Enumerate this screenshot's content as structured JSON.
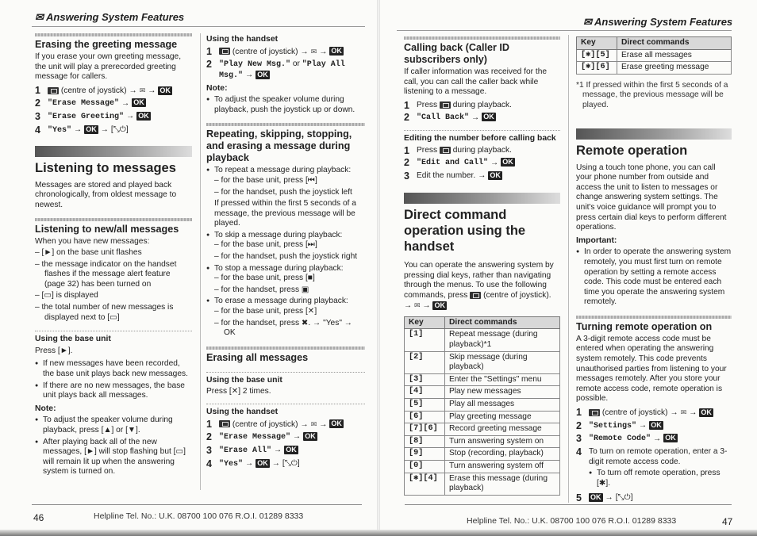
{
  "header": {
    "title": "Answering System Features",
    "icon": "answering-system-icon"
  },
  "icons": {
    "ok": "OK",
    "arrow": "→",
    "off": "[⤡⏻]"
  },
  "left_page": {
    "number": "46",
    "footer": "Helpline Tel. No.: U.K. 08700 100 076  R.O.I. 01289 8333",
    "erasing_greeting": {
      "title": "Erasing the greeting message",
      "intro": "If you erase your own greeting message, the unit will play a prerecorded greeting message for callers.",
      "steps": [
        {
          "n": "1",
          "text": "(centre of joystick)"
        },
        {
          "n": "2",
          "text": "\"Erase Message\""
        },
        {
          "n": "3",
          "text": "\"Erase Greeting\""
        },
        {
          "n": "4",
          "text": "\"Yes\""
        }
      ]
    },
    "listening": {
      "title": "Listening to messages",
      "intro": "Messages are stored and played back chronologically, from oldest message to newest."
    },
    "new_all": {
      "title": "Listening to new/all messages",
      "intro": "When you have new messages:",
      "items": [
        "– [►] on the base unit flashes",
        "– the message indicator on the handset flashes if the message alert feature (page 32) has been turned on",
        "– [▭] is displayed",
        "– the total number of new messages is displayed next to [▭]"
      ]
    },
    "base_unit": {
      "title": "Using the base unit",
      "press": "Press [►].",
      "bullets": [
        "If new messages have been recorded, the base unit plays back new messages.",
        "If there are no new messages, the base unit plays back all messages."
      ],
      "note_label": "Note:",
      "notes": [
        "To adjust the speaker volume during playback, press [▲] or [▼].",
        "After playing back all of the new messages, [►] will stop flashing but [▭] will remain lit up when the answering system is turned on."
      ]
    },
    "handset": {
      "title": "Using the handset",
      "steps": [
        {
          "n": "1",
          "text": "(centre of joystick)"
        },
        {
          "n": "2",
          "text_a": "\"Play New Msg.\"",
          "or": " or ",
          "text_b": "\"Play All Msg.\""
        }
      ],
      "note_label": "Note:",
      "notes": [
        "To adjust the speaker volume during playback, push the joystick up or down."
      ]
    },
    "repeating": {
      "title": "Repeating, skipping, stopping, and erasing a message during playback",
      "groups": [
        {
          "bullet": "To repeat a message during playback:",
          "items": [
            "– for the base unit, press [⏮]",
            "– for the handset, push the joystick left"
          ],
          "extra": "If pressed within the first 5 seconds of a message, the previous message will be played."
        },
        {
          "bullet": "To skip a message during playback:",
          "items": [
            "– for the base unit, press [⏭]",
            "– for the handset, push the joystick right"
          ]
        },
        {
          "bullet": "To stop a message during playback:",
          "items": [
            "– for the base unit, press [■]",
            "– for the handset, press ▣"
          ]
        },
        {
          "bullet": "To erase a message during playback:",
          "items": [
            "– for the base unit, press [✕]",
            "– for the handset, press ✖. → \"Yes\" → OK"
          ]
        }
      ]
    },
    "erasing_all": {
      "title": "Erasing all messages",
      "base_title": "Using the base unit",
      "base_text": "Press [✕] 2 times.",
      "handset_title": "Using the handset",
      "steps": [
        {
          "n": "1",
          "text": "(centre of joystick)"
        },
        {
          "n": "2",
          "text": "\"Erase Message\""
        },
        {
          "n": "3",
          "text": "\"Erase All\""
        },
        {
          "n": "4",
          "text": "\"Yes\""
        }
      ]
    }
  },
  "right_page": {
    "number": "47",
    "footer": "Helpline Tel. No.: U.K. 08700 100 076  R.O.I. 01289 8333",
    "calling_back": {
      "title": "Calling back (Caller ID subscribers only)",
      "intro": "If caller information was received for the call, you can call the caller back while listening to a message.",
      "steps": [
        {
          "n": "1",
          "pre": "Press",
          "post": "during playback."
        },
        {
          "n": "2",
          "text": "\"Call Back\""
        }
      ]
    },
    "editing": {
      "title": "Editing the number before calling back",
      "steps": [
        {
          "n": "1",
          "pre": "Press",
          "post": "during playback."
        },
        {
          "n": "2",
          "text": "\"Edit and Call\""
        },
        {
          "n": "3",
          "text": "Edit the number."
        }
      ]
    },
    "direct": {
      "title": "Direct command operation using the handset",
      "intro": "You can operate the answering system by pressing dial keys, rather than navigating through the menus. To use the following commands, press",
      "intro_post": "(centre of joystick).",
      "table": {
        "headers": [
          "Key",
          "Direct commands"
        ],
        "rows": [
          [
            "[1]",
            "Repeat message (during playback)*1"
          ],
          [
            "[2]",
            "Skip message (during playback)"
          ],
          [
            "[3]",
            "Enter the \"Settings\" menu"
          ],
          [
            "[4]",
            "Play new messages"
          ],
          [
            "[5]",
            "Play all messages"
          ],
          [
            "[6]",
            "Play greeting message"
          ],
          [
            "[7][6]",
            "Record greeting message"
          ],
          [
            "[8]",
            "Turn answering system on"
          ],
          [
            "[9]",
            "Stop (recording, playback)"
          ],
          [
            "[0]",
            "Turn answering system off"
          ],
          [
            "[✱][4]",
            "Erase this message (during playback)"
          ]
        ]
      }
    },
    "table2": {
      "headers": [
        "Key",
        "Direct commands"
      ],
      "rows": [
        [
          "[✱][5]",
          "Erase all messages"
        ],
        [
          "[✱][6]",
          "Erase greeting message"
        ]
      ],
      "footnote": "*1 If pressed within the first 5 seconds of a message, the previous message will be played."
    },
    "remote": {
      "title": "Remote operation",
      "intro": "Using a touch tone phone, you can call your phone number from outside and access the unit to listen to messages or change answering system settings. The unit's voice guidance will prompt you to press certain dial keys to perform different operations.",
      "important_label": "Important:",
      "important": "In order to operate the answering system remotely, you must first turn on remote operation by setting a remote access code. This code must be entered each time you operate the answering system remotely."
    },
    "turning_on": {
      "title": "Turning remote operation on",
      "intro": "A 3-digit remote access code must be entered when operating the answering system remotely. This code prevents unauthorised parties from listening to your messages remotely. After you store your remote access code, remote operation is possible.",
      "steps": [
        {
          "n": "1",
          "text": "(centre of joystick)"
        },
        {
          "n": "2",
          "text": "\"Settings\""
        },
        {
          "n": "3",
          "text": "\"Remote Code\""
        },
        {
          "n": "4",
          "text": "To turn on remote operation, enter a 3-digit remote access code.",
          "sub": "To turn off remote operation, press [✱]."
        },
        {
          "n": "5",
          "text": ""
        }
      ]
    }
  }
}
